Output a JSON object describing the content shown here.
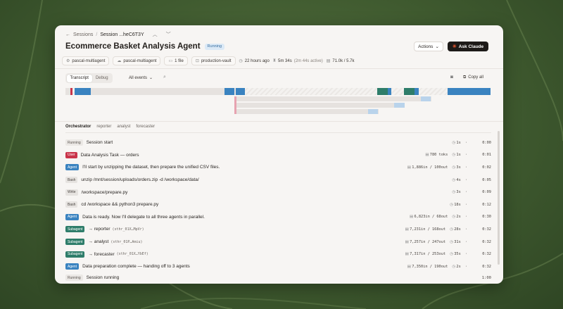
{
  "breadcrumb": {
    "back": "Sessions",
    "separator": "/",
    "current": "Session ...heC6T3Y"
  },
  "header": {
    "title": "Ecommerce Basket Analysis Agent",
    "status": "Running",
    "actions_label": "Actions",
    "ask_label": "Ask Claude"
  },
  "meta": {
    "agent": "pascal-multiagent",
    "env": "pascal-multiagent",
    "files": "1 file",
    "vault": "production-vault",
    "age": "22 hours ago",
    "duration": "5m 34s",
    "duration_active": "(2m 44s active)",
    "tokens": "71.0k / 5.7k"
  },
  "toolbar": {
    "view_transcript": "Transcript",
    "view_debug": "Debug",
    "filter_label": "All events",
    "copy_all": "Copy all"
  },
  "colors": {
    "agent": "#3a83c0",
    "user": "#c9344a",
    "subagent": "#2e7d6a",
    "brand": "#e0552f"
  },
  "agent_tabs": [
    "Orchestrator",
    "reporter",
    "analyst",
    "forecaster"
  ],
  "events": [
    {
      "tag": "Running",
      "text": "Session start",
      "mono": false,
      "sid": "",
      "tokens": "",
      "time": "1s",
      "clock": "0:00"
    },
    {
      "tag": "User",
      "text": "Data Analysis Task — orders",
      "mono": false,
      "sid": "",
      "tokens": "780 toks",
      "time": "1s",
      "clock": "0:01"
    },
    {
      "tag": "Agent",
      "text": "I'll start by unzipping the dataset, then prepare the unified CSV files.",
      "mono": false,
      "sid": "",
      "tokens": "1,886in / 100out",
      "time": "3s",
      "clock": "0:02"
    },
    {
      "tag": "Bash",
      "text": "unzip /mnt/session/uploads/orders.zip -d /workspace/data/",
      "mono": false,
      "sid": "",
      "tokens": "",
      "time": "4s",
      "clock": "0:05"
    },
    {
      "tag": "Write",
      "text": "/workspace/prepare.py",
      "mono": false,
      "sid": "",
      "tokens": "",
      "time": "3s",
      "clock": "0:09"
    },
    {
      "tag": "Bash",
      "text": "cd /workspace && python3 prepare.py",
      "mono": false,
      "sid": "",
      "tokens": "",
      "time": "18s",
      "clock": "0:12"
    },
    {
      "tag": "Agent",
      "text": "Data is ready. Now I'll delegate to all three agents in parallel.",
      "mono": false,
      "sid": "",
      "tokens": "6,823in / 68out",
      "time": "2s",
      "clock": "0:30"
    },
    {
      "tag": "Subagent",
      "text": "→ reporter",
      "mono": false,
      "sid": "(sthr_01X…MpVr)",
      "tokens": "7,231in / 168out",
      "time": "28s",
      "clock": "0:32"
    },
    {
      "tag": "Subagent",
      "text": "→ analyst",
      "mono": false,
      "sid": "(sthr_01P…Amiu)",
      "tokens": "7,257in / 247out",
      "time": "31s",
      "clock": "0:32"
    },
    {
      "tag": "Subagent",
      "text": "→ forecaster",
      "mono": false,
      "sid": "(sthr_01X…YbEf)",
      "tokens": "7,317in / 253out",
      "time": "35s",
      "clock": "0:32"
    },
    {
      "tag": "Agent",
      "text": "Data preparation complete — handing off to 3 agents",
      "mono": false,
      "sid": "",
      "tokens": "7,350in / 190out",
      "time": "2s",
      "clock": "0:32"
    }
  ],
  "footer": {
    "tag": "Running",
    "text": "Session running",
    "clock": "1:00"
  }
}
